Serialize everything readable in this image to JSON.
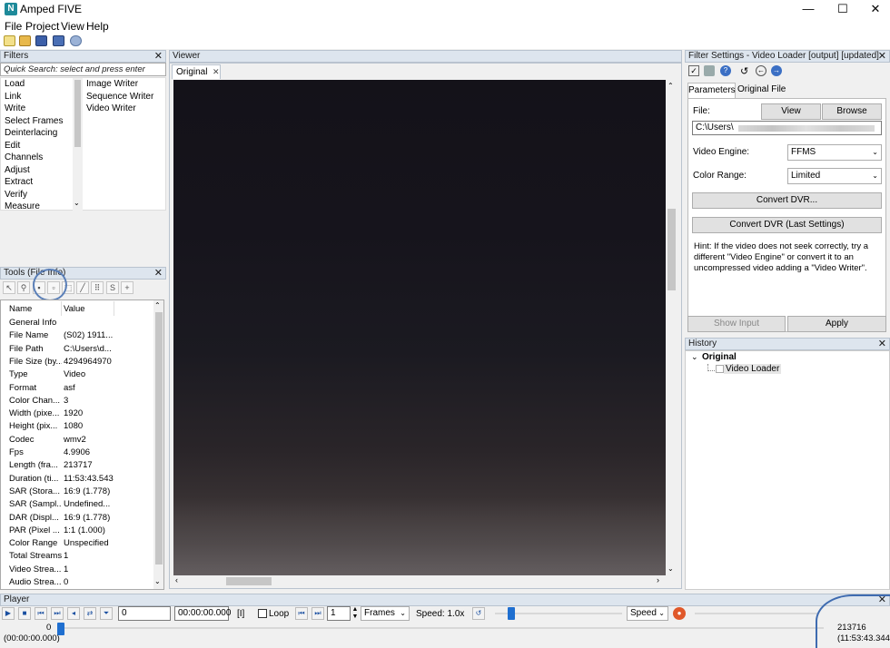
{
  "app": {
    "title": "Amped FIVE",
    "logo_letter": "N"
  },
  "window_controls": {
    "minimize": "—",
    "maximize": "☐",
    "close": "✕"
  },
  "menu": [
    "File",
    "Project",
    "View",
    "Help"
  ],
  "filters_panel": {
    "title": "Filters",
    "search_placeholder": "Quick Search: select and press enter",
    "categories": [
      "Load",
      "Link",
      "Write",
      "Select Frames",
      "Deinterlacing",
      "Edit",
      "Channels",
      "Adjust",
      "Extract",
      "Verify",
      "Measure"
    ],
    "writers": [
      "Image Writer",
      "Sequence Writer",
      "Video Writer"
    ]
  },
  "tools_panel": {
    "title": "Tools (File Info)",
    "columns": [
      "Name",
      "Value"
    ],
    "rows": [
      [
        "General Info",
        ""
      ],
      [
        "File Name",
        "(S02) 1911..."
      ],
      [
        "File Path",
        "C:\\Users\\d..."
      ],
      [
        "File Size (by...",
        "4294964970"
      ],
      [
        "Type",
        "Video"
      ],
      [
        "Format",
        "asf"
      ],
      [
        "Color Chan...",
        "3"
      ],
      [
        "Width (pixe...",
        "1920"
      ],
      [
        "Height (pix...",
        "1080"
      ],
      [
        "Codec",
        "wmv2"
      ],
      [
        "Fps",
        "4.9906"
      ],
      [
        "Length (fra...",
        "213717"
      ],
      [
        "Duration (ti...",
        "11:53:43.543"
      ],
      [
        "SAR (Stora...",
        "16:9 (1.778)"
      ],
      [
        "SAR (Sampl...",
        "Undefined..."
      ],
      [
        "DAR (Displ...",
        "16:9 (1.778)"
      ],
      [
        "PAR (Pixel ...",
        "1:1 (1.000)"
      ],
      [
        "Color Range",
        "Unspecified"
      ],
      [
        "Total Streams",
        "1"
      ],
      [
        "Video Strea...",
        "1"
      ],
      [
        "Audio Strea...",
        "0"
      ]
    ]
  },
  "viewer": {
    "title": "Viewer",
    "tab_label": "Original",
    "tab_close": "✕"
  },
  "filter_settings": {
    "title": "Filter Settings - Video Loader [output] [updated]",
    "tabs": [
      "Parameters",
      "Original File"
    ],
    "file_label": "File:",
    "view_button": "View",
    "browse_button": "Browse",
    "file_value": "C:\\Users\\",
    "video_engine_label": "Video Engine:",
    "video_engine_value": "FFMS",
    "color_range_label": "Color Range:",
    "color_range_value": "Limited",
    "convert_dvr_button": "Convert DVR...",
    "convert_dvr_last_button": "Convert DVR (Last Settings)",
    "hint": "Hint: If the video does not seek correctly, try a different \"Video Engine\" or convert it to an uncompressed video adding a \"Video Writer\".",
    "show_input_button": "Show Input",
    "apply_button": "Apply"
  },
  "history": {
    "title": "History",
    "root": "Original",
    "child": "Video Loader"
  },
  "player": {
    "title": "Player",
    "frame_input": "0",
    "time_input": "00:00:00.000",
    "bracket_label": "[I]",
    "loop_label": "Loop",
    "step_value": "1",
    "unit_select": "Frames",
    "speed_text": "Speed: 1.0x",
    "speed_select": "Speed",
    "slider_start_frame": "0",
    "slider_start_time": "(00:00:00.000)",
    "total_frames": "213716",
    "total_time": "(11:53:43.344)"
  }
}
